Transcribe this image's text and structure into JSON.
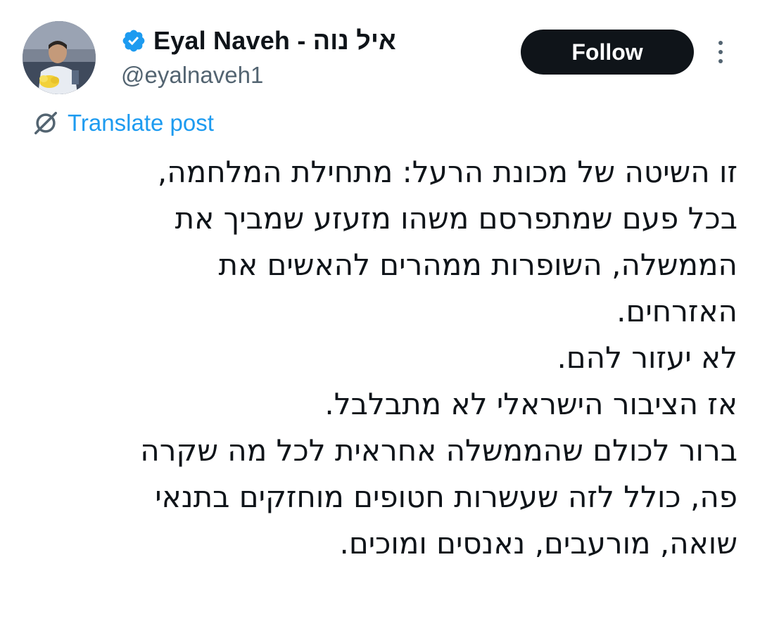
{
  "author": {
    "display_name": "Eyal Naveh - איל נוה",
    "handle": "@eyalnaveh1",
    "verified_icon": "verified-badge-icon",
    "avatar": "avatar-photo"
  },
  "actions": {
    "follow_label": "Follow",
    "more_icon": "more-options-icon"
  },
  "translate": {
    "icon": "translate-icon",
    "label": "Translate post"
  },
  "tweet": {
    "lines": [
      "זו השיטה של מכונת הרעל: מתחילת המלחמה,",
      "בכל פעם שמתפרסם משהו מזעזע שמביך את",
      "הממשלה, השופרות ממהרים להאשים את",
      "האזרחים.",
      "לא יעזור להם.",
      "אז הציבור הישראלי לא מתבלבל.",
      "ברור לכולם שהממשלה אחראית לכל מה שקרה",
      "פה, כולל לזה שעשרות חטופים מוחזקים בתנאי",
      "שואה, מורעבים, נאנסים ומוכים."
    ]
  },
  "colors": {
    "text": "#0f1419",
    "secondary": "#536471",
    "link": "#1d9bf0",
    "verified": "#1d9bf0",
    "follow_bg": "#0f1419",
    "follow_text": "#ffffff"
  }
}
